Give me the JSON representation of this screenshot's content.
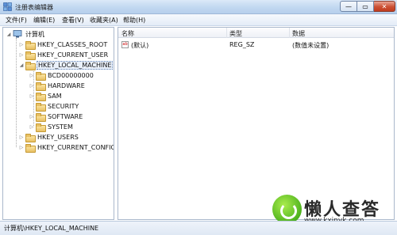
{
  "window": {
    "title": "注册表编辑器",
    "controls": {
      "minimize": "—",
      "maximize": "▭",
      "close": "✕"
    }
  },
  "menu": [
    "文件(F)",
    "编辑(E)",
    "查看(V)",
    "收藏夹(A)",
    "帮助(H)"
  ],
  "tree": {
    "root": "计算机",
    "hives": [
      "HKEY_CLASSES_ROOT",
      "HKEY_CURRENT_USER",
      "HKEY_LOCAL_MACHINE",
      "HKEY_USERS",
      "HKEY_CURRENT_CONFIG"
    ],
    "selected": "HKEY_LOCAL_MACHINE",
    "children": [
      "BCD00000000",
      "HARDWARE",
      "SAM",
      "SECURITY",
      "SOFTWARE",
      "SYSTEM"
    ]
  },
  "list": {
    "columns": [
      "名称",
      "类型",
      "数据"
    ],
    "rows": [
      {
        "name": "(默认)",
        "type": "REG_SZ",
        "data": "(数值未设置)"
      }
    ]
  },
  "status": "计算机\\HKEY_LOCAL_MACHINE",
  "watermark": {
    "text": "懒人查答",
    "url": "www.kxinyk.com"
  }
}
